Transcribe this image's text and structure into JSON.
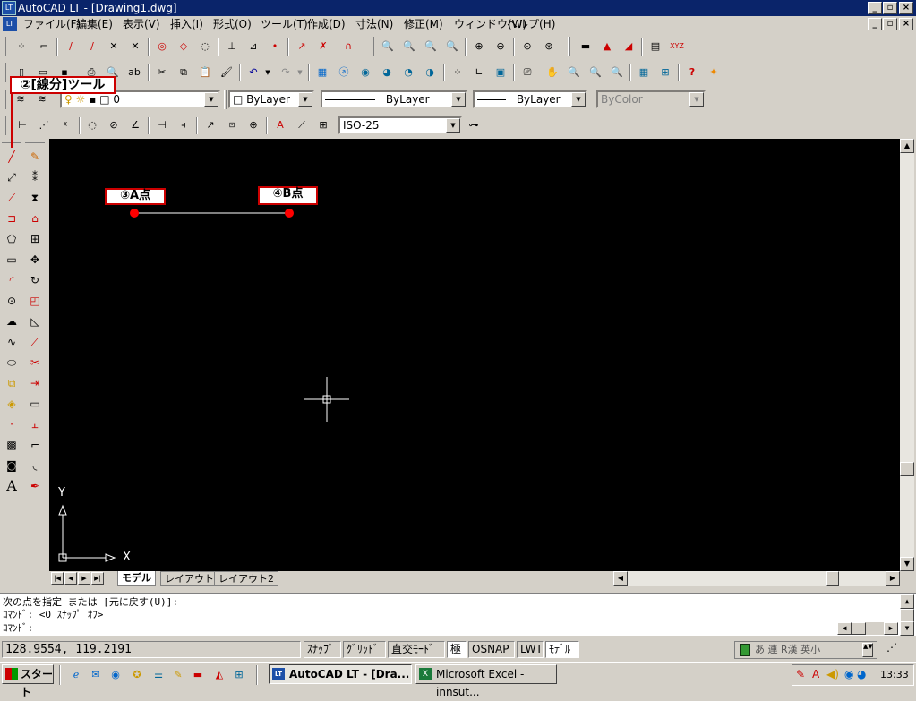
{
  "window": {
    "title": "AutoCAD LT - [Drawing1.dwg]",
    "app_icon": "autocad-lt-icon"
  },
  "menu": [
    "ファイル(F)",
    "編集(E)",
    "表示(V)",
    "挿入(I)",
    "形式(O)",
    "ツール(T)",
    "作成(D)",
    "寸法(N)",
    "修正(M)",
    "ウィンドウ(W)",
    "ヘルプ(H)"
  ],
  "properties": {
    "layer": "0",
    "color": "ByLayer",
    "linetype": "ByLayer",
    "lineweight": "ByLayer",
    "plotstyle": "ByColor"
  },
  "dimstyle": "ISO-25",
  "annotations": {
    "line_tool": "②[線分]ツール",
    "point_a": "③A点",
    "point_b": "④B点"
  },
  "ucs": {
    "x_label": "X",
    "y_label": "Y"
  },
  "layout_tabs": [
    "モデル",
    "レイアウト1",
    "レイアウト2"
  ],
  "command_lines": [
    "次の点を指定 または [元に戻す(U)]:",
    "ｺﾏﾝﾄﾞ:  <O ｽﾅｯﾌﾟ ｵﾌ>",
    "ｺﾏﾝﾄﾞ:"
  ],
  "status": {
    "coords": "128.9554, 119.2191",
    "buttons": [
      "ｽﾅｯﾌﾟ",
      "ｸﾞﾘｯﾄﾞ",
      "直交ﾓｰﾄﾞ",
      "極",
      "OSNAP",
      "LWT",
      "ﾓﾃﾞﾙ"
    ],
    "ime": "あ 連 R漢 英小"
  },
  "taskbar": {
    "start": "スタート",
    "tasks": [
      "AutoCAD LT - [Dra...",
      "Microsoft Excel - innsut..."
    ],
    "clock": "13:33"
  },
  "colors": {
    "title_bg": "#0a246a",
    "canvas_bg": "#000000",
    "callout_border": "#cc0000",
    "point_marker": "#ff0000"
  }
}
